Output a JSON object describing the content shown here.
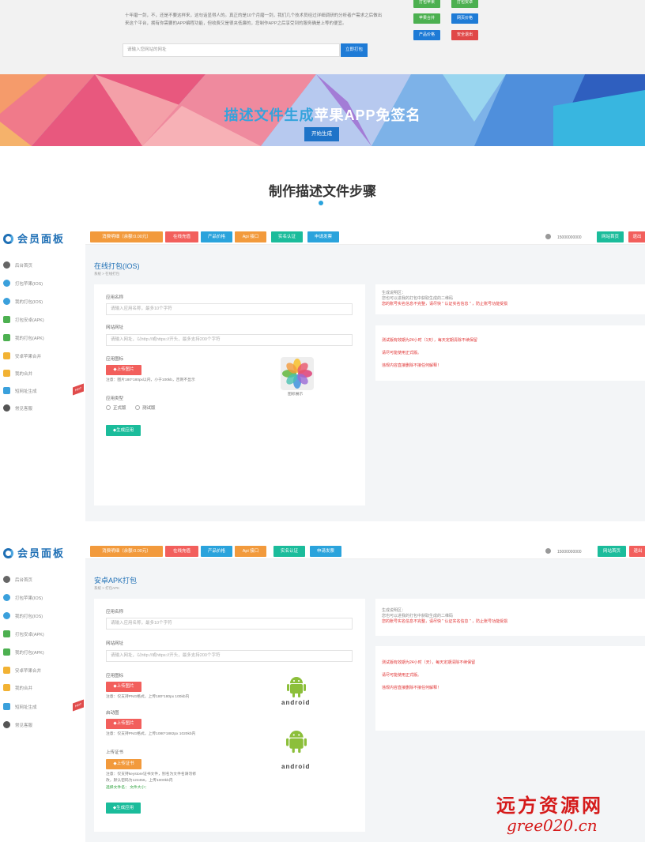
{
  "intro": {
    "paragraph": "十年磨一剑，不，还是不要这样来，这句话显得人的。真正的是10个月磨一剑，我们几个技术员经过详细调研的分析者户需求之后做出来这个平台，拥有你需要的APP编程功能，但收费又是很夹低廉的，您制作APP之后享受到的服务确是上等的便宜。",
    "url_placeholder": "请输入您网站的网址",
    "url_button": "立即打包",
    "quick_buttons": [
      "打包苹果",
      "打包安卓",
      "苹果合并",
      "网页价格",
      "产品价格",
      "安全退出"
    ]
  },
  "banner": {
    "title_highlight": "描述文件生成",
    "title_rest": "苹果APP免签名",
    "button": "开始生成"
  },
  "steps": {
    "title": "制作描述文件步骤"
  },
  "panel": {
    "logo": "会员面板",
    "sidebar": [
      "后台首页",
      "打包苹果(IOS)",
      "我的打包(IOS)",
      "打包安卓(APK)",
      "我的打包(APK)",
      "安卓苹果合并",
      "我的合并",
      "短网址生成",
      "常见客服"
    ],
    "hot_badge": "HOT",
    "top_buttons": [
      "消费明细（余额:0.00元）",
      "在线充值",
      "产品价格",
      "Api 接口",
      "实名认证",
      "申请发票"
    ],
    "user_phone": "15000000000",
    "home_button": "网站首页",
    "logout_button": "退出"
  },
  "ios": {
    "title": "在线打包(IOS)",
    "crumb_home": "系统",
    "crumb_current": "在线打包",
    "app_name_label": "应用名称",
    "app_name_placeholder": "请输入应用名称，最多10个字符",
    "url_label": "网站网址",
    "url_placeholder": "请输入网址，以http://或https://开头，最多支持200个字符",
    "icon_label": "应用图标",
    "upload_button": "◆上传图片",
    "icon_note": "注意：图片180*180px以内，小于100kb，否则不显示",
    "icon_preview_caption": "图标展示",
    "type_label": "应用类型",
    "type_options": [
      "正式版",
      "测试版"
    ],
    "generate_button": "◆生成应用",
    "tips_title": "生成说明区：",
    "tips_line1": "您也可以进我的打包中获取生成的二维码",
    "tips_line2": "您的账号实名信息不完整，请尽快 \" 认证实名信息 \" ，防止账号功能受损",
    "tips_red1": "测试版有效期为24小时（1天），每天定期清除不续保留",
    "tips_red2": "请尽可能使用正式版。",
    "tips_red3": "违规内容直接删除不接任何解释！"
  },
  "apk": {
    "title": "安卓APK打包",
    "crumb_home": "系统",
    "crumb_current": "打包APK",
    "app_name_label": "应用名称",
    "app_name_placeholder": "请输入应用名称，最多10个字符",
    "url_label": "网站网址",
    "url_placeholder": "请输入网址，以http://或https://开头，最多支持200个字符",
    "icon_label": "应用图标",
    "upload_button": "◆上传图片",
    "icon_note": "注意：仅支持PNG格式，上传180*180px 100kb内",
    "splash_label": "启动图",
    "splash_button": "◆上传图片",
    "splash_note": "注意：仅支持PNG格式，上传1080*1882px 1020kb内",
    "cert_label": "上传证书",
    "cert_button": "◆上传证书",
    "cert_note1": "注意：仅支持keystore证书文件，别名为文件名请勿修",
    "cert_note2": "改，默认密码为123456，上传1000kb内",
    "cert_selected": "选择文件名：  文件大小：",
    "generate_button": "◆生成应用",
    "android_word": "android",
    "tips_title": "生成说明区：",
    "tips_line1": "您也可以进我的打包中获取生成的二维码",
    "tips_line2": "您的账号实名信息不完整，请尽快 \" 认证实名信息 \" ，防止账号功能受损",
    "tips_red1": "测试版有效期为24小时（天），每天定期清除不续保留",
    "tips_red2": "请尽可能使用正式版。",
    "tips_red3": "违规内容直接删除不接任何解释！"
  },
  "watermark": {
    "line1": "远方资源网",
    "line2": "gree020.cn"
  },
  "colors": {
    "blue": "#1e6fb5",
    "green": "#1bbc9b",
    "red": "#f25f5c",
    "orange": "#f29a3c"
  }
}
